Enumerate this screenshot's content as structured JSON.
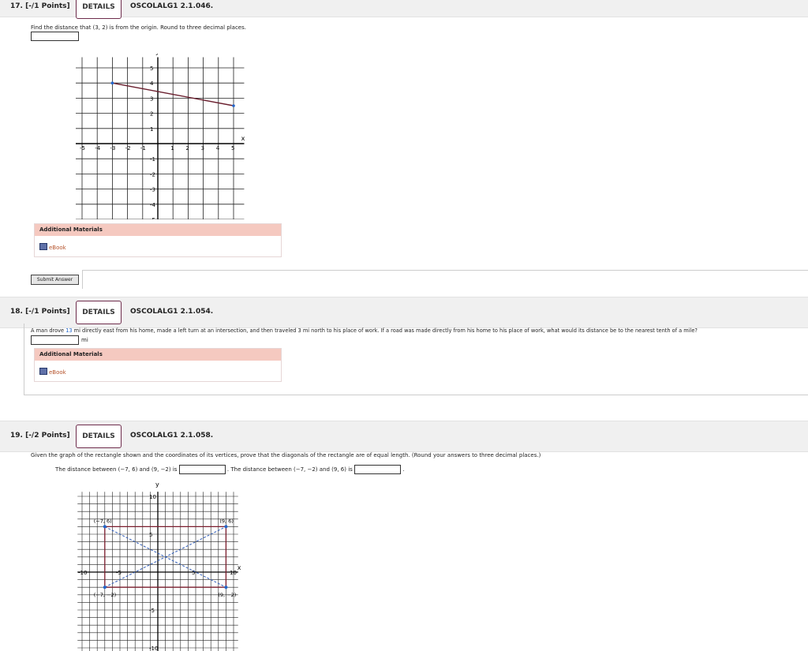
{
  "q17": {
    "num": "17. [-/1 Points]",
    "details": "DETAILS",
    "code": "OSCOLALG1 2.1.046.",
    "prompt": "Find the distance that (3, 2) is from the origin. Round to three decimal places.",
    "answer": "",
    "graph": {
      "x_ticks": [
        "-5",
        "-4",
        "-3",
        "-2",
        "-1",
        "1",
        "2",
        "3",
        "4",
        "5"
      ],
      "y_ticks": [
        "5",
        "4",
        "3",
        "2",
        "1",
        "-1",
        "-2",
        "-3",
        "-4",
        "-5"
      ],
      "x_label": "x",
      "y_label": "y",
      "segment": [
        [
          -3,
          4
        ],
        [
          5,
          2.5
        ]
      ],
      "line_color": "#6a1f2e",
      "point_color": "#2266cc"
    },
    "materials_title": "Additional Materials",
    "ebook": "eBook",
    "submit": "Submit Answer"
  },
  "q18": {
    "num": "18. [-/1 Points]",
    "details": "DETAILS",
    "code": "OSCOLALG1 2.1.054.",
    "prompt_a": "A man drove ",
    "prompt_num": "13",
    "prompt_b": " mi directly east from his home, made a left turn at an intersection, and then traveled 3 mi north to his place of work. If a road was made directly from his home to his place of work, what would its distance be to the nearest tenth of a mile?",
    "answer": "",
    "unit": "mi",
    "materials_title": "Additional Materials",
    "ebook": "eBook"
  },
  "q19": {
    "num": "19. [-/2 Points]",
    "details": "DETAILS",
    "code": "OSCOLALG1 2.1.058.",
    "prompt": "Given the graph of the rectangle shown and the coordinates of its vertices, prove that the diagonals of the rectangle are of equal length. (Round your answers to three decimal places.)",
    "dist1_a": "The distance between (−7, 6) and (9, −2) is",
    "dist1_b": ". The distance between (−7, −2) and (9, 6) is",
    "dist1_c": ".",
    "answer1": "",
    "answer2": "",
    "graph": {
      "x_ticks": [
        "-10",
        "-5",
        "5",
        "10"
      ],
      "y_ticks": [
        "10",
        "5",
        "-5",
        "-10"
      ],
      "x_label": "x",
      "y_label": "y",
      "vertices": [
        {
          "label": "(−7, 6)",
          "x": -7,
          "y": 6
        },
        {
          "label": "(9, 6)",
          "x": 9,
          "y": 6
        },
        {
          "label": "(9, −2)",
          "x": 9,
          "y": -2
        },
        {
          "label": "(−7, −2)",
          "x": -7,
          "y": -2
        }
      ],
      "rect_color": "#7a1c2c",
      "diag_color": "#2e5bb8"
    }
  }
}
